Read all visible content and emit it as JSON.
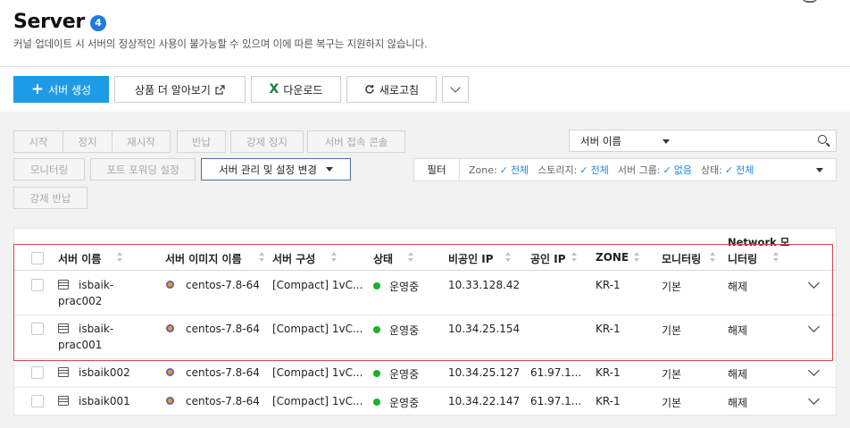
{
  "page": {
    "title": "Server",
    "count": "4",
    "subtitle": "커널 업데이트 시 서버의 정상적인 사용이 불가능할 수 있으며 이에 따른 복구는 지원하지 않습니다."
  },
  "toolbar": {
    "create_label": "서버 생성",
    "learn_more_label": "상품 더 알아보기",
    "download_label": "다운로드",
    "refresh_label": "새로고침"
  },
  "actions": {
    "start": "시작",
    "stop": "정지",
    "restart": "재시작",
    "return": "반납",
    "force_stop": "강제 정지",
    "console": "서버 접속 콘솔",
    "monitoring": "모니터링",
    "port_forwarding": "포트 포워딩 설정",
    "manage": "서버 관리 및 설정 변경",
    "force_return": "강제 반납"
  },
  "search": {
    "field_selected": "서버 이름",
    "placeholder": ""
  },
  "filter": {
    "button_label": "필터",
    "zone_label": "Zone:",
    "zone_value": "전체",
    "storage_label": "스토리지:",
    "storage_value": "전체",
    "group_label": "서버 그룹:",
    "group_value": "없음",
    "status_label": "상태:",
    "status_value": "전체"
  },
  "table": {
    "columns": {
      "name": "서버 이름",
      "image": "서버 이미지 이름",
      "spec": "서버 구성",
      "status": "상태",
      "private_ip": "비공인 IP",
      "public_ip": "공인 IP",
      "zone": "ZONE",
      "monitoring": "모니터링",
      "net_monitoring_l1": "Network 모",
      "net_monitoring_l2": "니터링"
    },
    "rows": [
      {
        "name_l1": "isbaik-",
        "name_l2": "prac002",
        "image": "centos-7.8-64",
        "spec": "[Compact] 1vC...",
        "status": "운영중",
        "private_ip": "10.33.128.42",
        "public_ip": "",
        "zone": "KR-1",
        "monitoring": "기본",
        "net_monitoring": "해제"
      },
      {
        "name_l1": "isbaik-",
        "name_l2": "prac001",
        "image": "centos-7.8-64",
        "spec": "[Compact] 1vC...",
        "status": "운영중",
        "private_ip": "10.34.25.154",
        "public_ip": "",
        "zone": "KR-1",
        "monitoring": "기본",
        "net_monitoring": "해제"
      },
      {
        "name": "isbaik002",
        "image": "centos-7.8-64",
        "spec": "[Compact] 1vC...",
        "status": "운영중",
        "private_ip": "10.34.25.127",
        "public_ip": "61.97.1...",
        "zone": "KR-1",
        "monitoring": "기본",
        "net_monitoring": "해제"
      },
      {
        "name": "isbaik001",
        "image": "centos-7.8-64",
        "spec": "[Compact] 1vC...",
        "status": "운영중",
        "private_ip": "10.34.22.147",
        "public_ip": "61.97.1...",
        "zone": "KR-1",
        "monitoring": "기본",
        "net_monitoring": "해제"
      }
    ]
  },
  "colors": {
    "primary": "#1e9be6",
    "badge": "#1f7ae0",
    "status_running": "#1ab12a",
    "highlight": "#e0444c",
    "filter_value": "#1e88e5"
  },
  "icons": {
    "create": "plus-icon",
    "learn_more": "external-link-icon",
    "download": "excel-icon",
    "refresh": "refresh-icon",
    "search": "search-icon",
    "server": "server-icon",
    "os": "centos-icon",
    "expand": "chevron-down-icon"
  }
}
